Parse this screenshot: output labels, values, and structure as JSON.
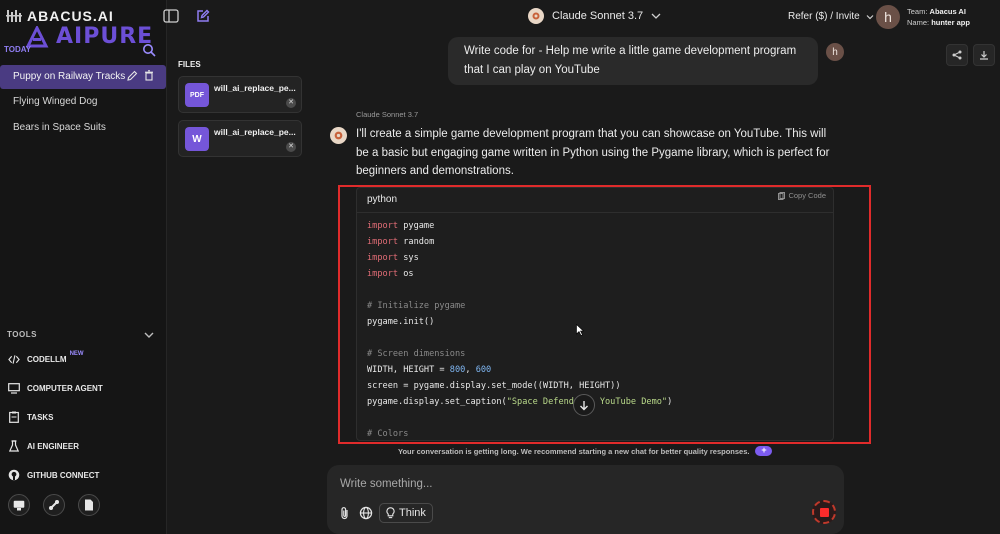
{
  "brand": {
    "name": "ABACUS.AI",
    "watermark": "AIPURE"
  },
  "sidebar": {
    "section_today": "TODAY",
    "chats": [
      {
        "label": "Puppy on Railway Tracks"
      },
      {
        "label": "Flying Winged Dog"
      },
      {
        "label": "Bears in Space Suits"
      }
    ],
    "tools_label": "TOOLS",
    "tools": [
      {
        "label": "CODELLM",
        "badge": "NEW",
        "icon": "code-icon"
      },
      {
        "label": "COMPUTER AGENT",
        "icon": "monitor-icon"
      },
      {
        "label": "TASKS",
        "icon": "clipboard-icon"
      },
      {
        "label": "AI ENGINEER",
        "icon": "flask-icon"
      },
      {
        "label": "GITHUB CONNECT",
        "icon": "github-icon"
      }
    ]
  },
  "header": {
    "model": "Claude Sonnet 3.7",
    "refer": "Refer ($) / Invite",
    "avatar_letter": "h",
    "team_label": "Team:",
    "team_value": "Abacus AI",
    "name_label": "Name:",
    "name_value": "hunter app"
  },
  "files": {
    "title": "FILES",
    "items": [
      {
        "name": "will_ai_replace_pe...",
        "type": "PDF"
      },
      {
        "name": "will_ai_replace_pe...",
        "type": "W"
      }
    ]
  },
  "conversation": {
    "user_message": "Write code for - Help me write a little game development program that I can play on YouTube",
    "user_avatar": "h",
    "assistant_model": "Claude Sonnet 3.7",
    "assistant_intro": "I'll create a simple game development program that you can showcase on YouTube. This will be a basic but engaging game written in Python using the Pygame library, which is perfect for beginners and demonstrations.",
    "code": {
      "language": "python",
      "copy_label": "Copy Code",
      "comment_init": "# Initialize pygame",
      "comment_screen": "# Screen dimensions",
      "comment_colors": "# Colors",
      "caption_string": "\"Space Defender - YouTube Demo\""
    }
  },
  "notice": "Your conversation is getting long. We recommend starting a new chat for better quality responses.",
  "composer": {
    "placeholder": "Write something...",
    "think_label": "Think"
  },
  "colors": {
    "accent": "#7c5cf0",
    "active_chat": "#4a3b82",
    "highlight_border": "#e02b2b",
    "stop": "#ff2b2b"
  }
}
